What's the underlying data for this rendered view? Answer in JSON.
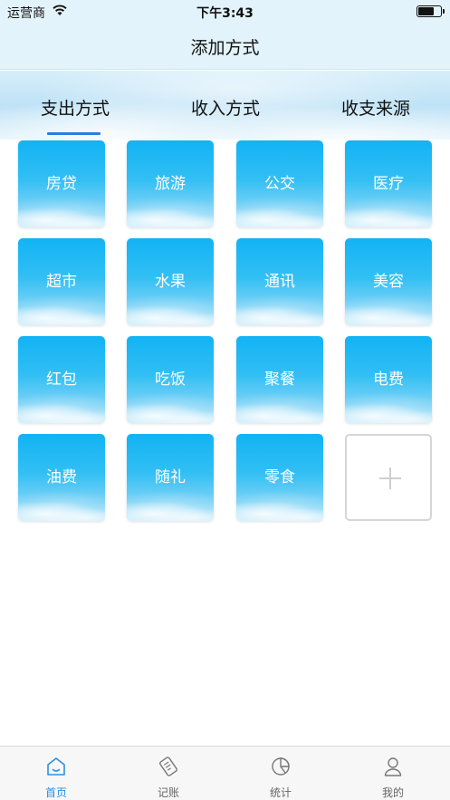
{
  "status_bar": {
    "carrier": "运营商",
    "time": "下午3:43"
  },
  "header": {
    "title": "添加方式"
  },
  "tabs": [
    {
      "label": "支出方式",
      "active": true
    },
    {
      "label": "收入方式",
      "active": false
    },
    {
      "label": "收支来源",
      "active": false
    }
  ],
  "categories": [
    "房贷",
    "旅游",
    "公交",
    "医疗",
    "超市",
    "水果",
    "通讯",
    "美容",
    "红包",
    "吃饭",
    "聚餐",
    "电费",
    "油费",
    "随礼",
    "零食"
  ],
  "add_tile": {
    "icon": "plus-icon"
  },
  "bottom_nav": [
    {
      "label": "首页",
      "icon": "home-icon",
      "active": true
    },
    {
      "label": "记账",
      "icon": "note-icon",
      "active": false
    },
    {
      "label": "统计",
      "icon": "pie-chart-icon",
      "active": false
    },
    {
      "label": "我的",
      "icon": "user-icon",
      "active": false
    }
  ],
  "colors": {
    "accent": "#2b7fdc",
    "tile_top": "#12b3f4",
    "header_bg": "#e3f3fb"
  }
}
